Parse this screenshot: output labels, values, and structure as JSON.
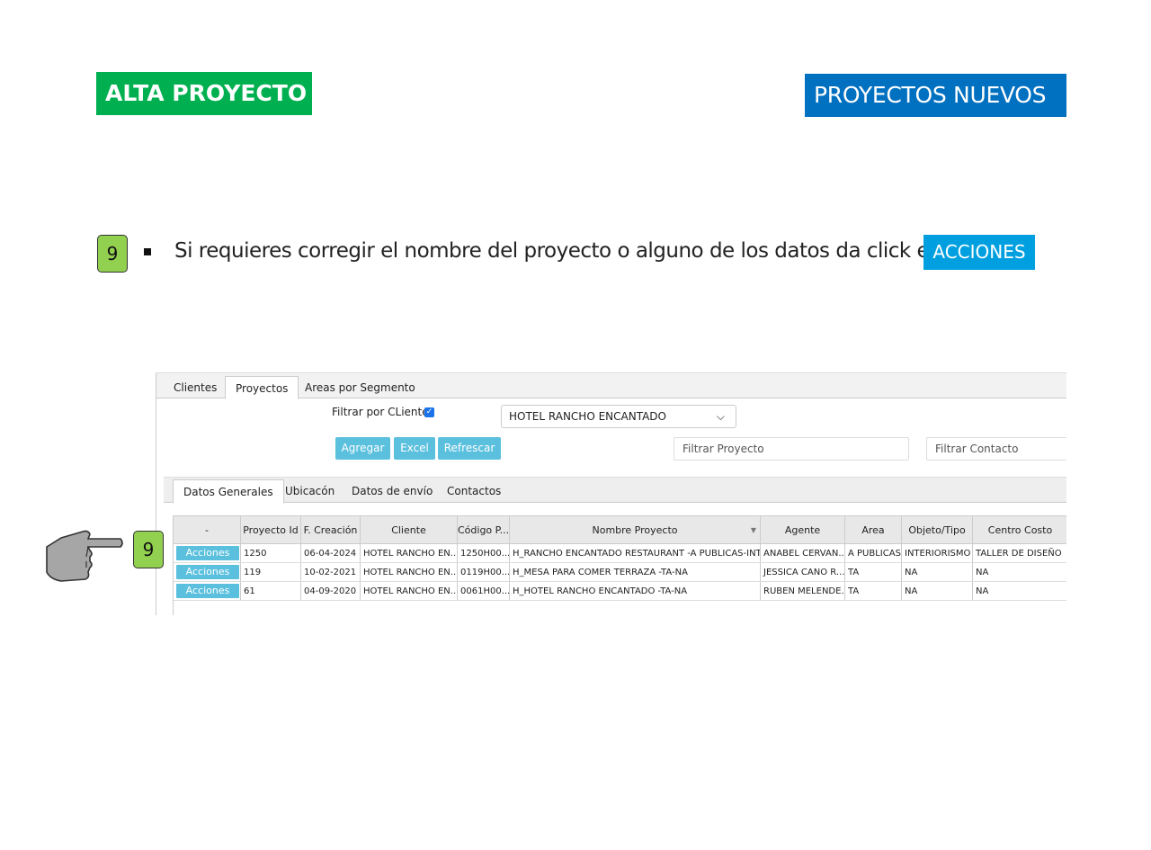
{
  "header": {
    "left_title": "ALTA PROYECTO",
    "right_title": "PROYECTOS NUEVOS"
  },
  "instruction": {
    "step": "9",
    "text": "Si requieres corregir el nombre del proyecto o alguno de los datos da click en",
    "chip": "ACCIONES"
  },
  "app": {
    "main_tabs": [
      {
        "label": "Clientes"
      },
      {
        "label": "Proyectos"
      },
      {
        "label": "Areas por Segmento"
      }
    ],
    "filter_label": "Filtrar por CLiente",
    "client_select": "HOTEL RANCHO ENCANTADO",
    "buttons": {
      "add": "Agregar",
      "excel": "Excel",
      "refresh": "Refrescar"
    },
    "placeholders": {
      "project": "Filtrar Proyecto",
      "contact": "Filtrar Contacto"
    },
    "inner_tabs": [
      {
        "label": "Datos Generales"
      },
      {
        "label": "Ubicacón"
      },
      {
        "label": "Datos de envío"
      },
      {
        "label": "Contactos"
      }
    ],
    "grid": {
      "columns": [
        "-",
        "Proyecto Id",
        "F. Creación",
        "Cliente",
        "Código P...",
        "Nombre Proyecto",
        "Agente",
        "Area",
        "Objeto/Tipo",
        "Centro Costo"
      ],
      "action_label": "Acciones",
      "rows": [
        {
          "id": "1250",
          "fecha": "06-04-2024",
          "cliente": "HOTEL RANCHO EN...",
          "codigo": "1250H00...",
          "nombre": "H_RANCHO ENCANTADO RESTAURANT -A PUBLICAS-INTR",
          "agente": "ANABEL CERVAN...",
          "area": "A PUBLICAS",
          "objeto": "INTERIORISMO",
          "centro": "TALLER DE DISEÑO"
        },
        {
          "id": "119",
          "fecha": "10-02-2021",
          "cliente": "HOTEL RANCHO EN...",
          "codigo": "0119H00...",
          "nombre": "H_MESA PARA COMER TERRAZA -TA-NA",
          "agente": "JESSICA CANO R...",
          "area": "TA",
          "objeto": "NA",
          "centro": "NA"
        },
        {
          "id": "61",
          "fecha": "04-09-2020",
          "cliente": "HOTEL RANCHO EN...",
          "codigo": "0061H00...",
          "nombre": "H_HOTEL RANCHO ENCANTADO -TA-NA",
          "agente": "RUBEN MELENDE...",
          "area": "TA",
          "objeto": "NA",
          "centro": "NA"
        }
      ]
    }
  },
  "pointer": {
    "step": "9"
  },
  "colors": {
    "green": "#00b050",
    "blue": "#0070c0",
    "chip": "#00a0e0",
    "badge": "#92d050",
    "button": "#5bc0de"
  }
}
